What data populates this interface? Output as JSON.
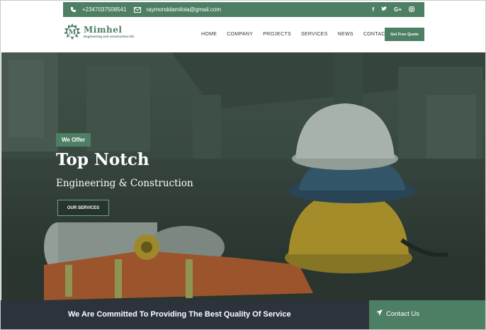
{
  "topbar": {
    "phone": "+2347037508541",
    "email": "raymonddamilola@gmail.com",
    "social": [
      "f",
      "t",
      "G+",
      "ig"
    ]
  },
  "logo": {
    "name": "Mimhel",
    "tagline": "Engineering and construction ltd."
  },
  "nav": {
    "items": [
      "HOME",
      "COMPANY",
      "PROJECTS",
      "SERVICES",
      "NEWS",
      "CONTACT"
    ]
  },
  "header": {
    "cta_label": "Get Free Quote"
  },
  "hero": {
    "badge": "We Offer",
    "title": "Top Notch",
    "subtitle": "Engineering & Construction",
    "button_label": "OUR SERVICES"
  },
  "footer_bar": {
    "message": "We Are Committed To Providing The Best Quality Of Service",
    "contact_label": "Contact Us"
  },
  "colors": {
    "brand": "#4d7f64",
    "dark": "#2d333c"
  }
}
